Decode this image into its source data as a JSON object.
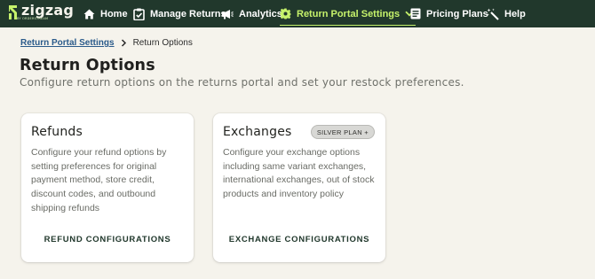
{
  "brand": {
    "name": "zigzag",
    "tagline": "BY ORDERSTREAM"
  },
  "colors": {
    "nav_bg": "#21382c",
    "active_accent": "#c6f26b",
    "page_bg": "#f5f3ec",
    "link": "#2a5a8a"
  },
  "nav": {
    "items": [
      {
        "label": "Home",
        "icon": "home-icon"
      },
      {
        "label": "Manage Returns",
        "icon": "clipboard-icon"
      },
      {
        "label": "Analytics",
        "icon": "megaphone-icon"
      },
      {
        "label": "Return Portal Settings",
        "icon": "gear-icon",
        "active": true,
        "dropdown": "chevron-down-icon"
      },
      {
        "label": "Pricing Plans",
        "icon": "document-icon"
      },
      {
        "label": "Help",
        "icon": "magic-wand-icon"
      }
    ]
  },
  "breadcrumb": {
    "parent": "Return Portal Settings",
    "current": "Return Options"
  },
  "page": {
    "title": "Return Options",
    "subtitle": "Configure return options on the returns portal and set your restock preferences."
  },
  "cards": [
    {
      "title": "Refunds",
      "description": "Configure your refund options by setting preferences for original payment method, store credit, discount codes, and outbound shipping refunds",
      "action": "REFUND CONFIGURATIONS"
    },
    {
      "title": "Exchanges",
      "badge": "SILVER PLAN +",
      "description": "Configure your exchange options including same variant exchanges, international exchanges, out of stock products and inventory policy",
      "action": "EXCHANGE CONFIGURATIONS"
    }
  ]
}
